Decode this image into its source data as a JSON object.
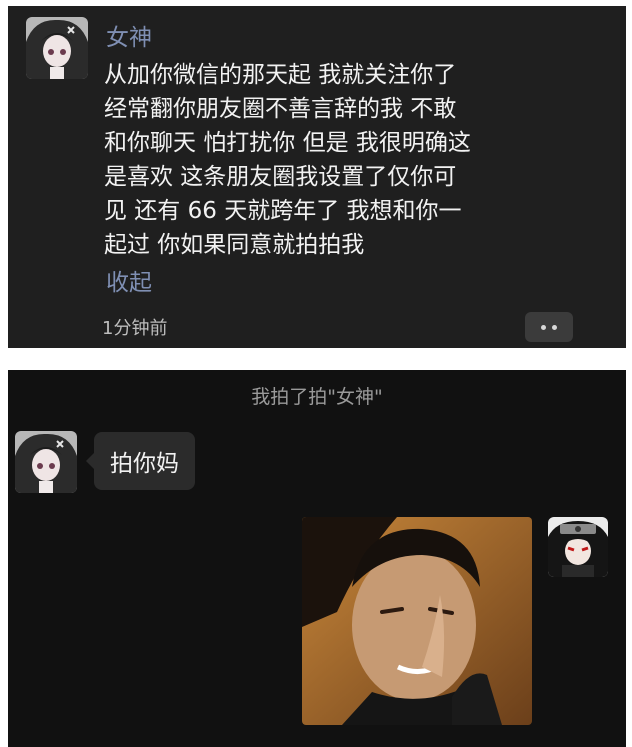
{
  "moment": {
    "author": "女神",
    "text": "从加你微信的那天起 我就关注你了\n经常翻你朋友圈不善言辞的我 不敢\n和你聊天 怕打扰你 但是 我很明确这\n是喜欢 这条朋友圈我设置了仅你可\n见 还有 66 天就跨年了 我想和你一\n起过 你如果同意就拍拍我",
    "collapse_label": "收起",
    "time": "1分钟前"
  },
  "chat": {
    "system_notice": "我拍了拍\"女神\"",
    "reply": "拍你妈"
  },
  "colors": {
    "background": "#1f1f1f",
    "name_link": "#7f8fb3",
    "bubble": "#2b2b2b"
  }
}
